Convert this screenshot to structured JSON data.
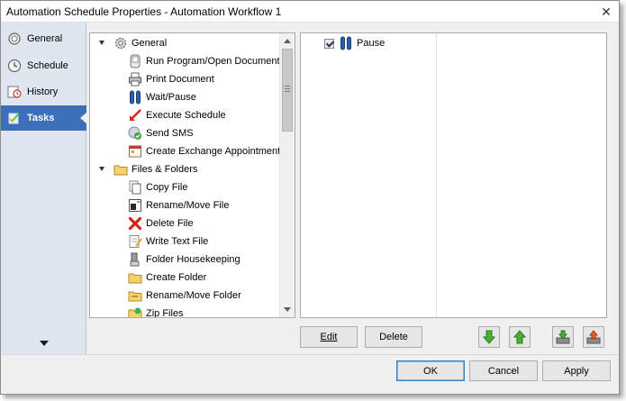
{
  "window": {
    "title": "Automation Schedule Properties - Automation Workflow 1",
    "close_glyph": "✕"
  },
  "sidebar": {
    "items": [
      {
        "label": "General",
        "icon": "general-icon",
        "active": false
      },
      {
        "label": "Schedule",
        "icon": "clock-icon",
        "active": false
      },
      {
        "label": "History",
        "icon": "history-icon",
        "active": false
      },
      {
        "label": "Tasks",
        "icon": "tasks-icon",
        "active": true
      }
    ],
    "accent": "#3d6fb8"
  },
  "task_tree": {
    "groups": [
      {
        "label": "General",
        "icon": "gear-icon",
        "items": [
          {
            "label": "Run Program/Open Document",
            "icon": "run-program-icon"
          },
          {
            "label": "Print Document",
            "icon": "printer-icon"
          },
          {
            "label": "Wait/Pause",
            "icon": "pause-icon"
          },
          {
            "label": "Execute Schedule",
            "icon": "execute-arrow-icon"
          },
          {
            "label": "Send SMS",
            "icon": "sms-icon"
          },
          {
            "label": "Create Exchange Appointment",
            "icon": "calendar-icon"
          }
        ]
      },
      {
        "label": "Files & Folders",
        "icon": "folder-icon",
        "items": [
          {
            "label": "Copy File",
            "icon": "copy-file-icon"
          },
          {
            "label": "Rename/Move File",
            "icon": "rename-file-icon"
          },
          {
            "label": "Delete File",
            "icon": "delete-x-icon"
          },
          {
            "label": "Write Text File",
            "icon": "write-text-icon"
          },
          {
            "label": "Folder Housekeeping",
            "icon": "housekeeping-icon"
          },
          {
            "label": "Create Folder",
            "icon": "create-folder-icon"
          },
          {
            "label": "Rename/Move Folder",
            "icon": "rename-folder-icon"
          },
          {
            "label": "Zip Files",
            "icon": "zip-icon"
          }
        ]
      }
    ]
  },
  "selected_tasks": [
    {
      "label": "Pause",
      "checked": true,
      "icon": "pause-icon"
    }
  ],
  "task_buttons": {
    "edit": "Edit",
    "delete": "Delete"
  },
  "footer": {
    "ok": "OK",
    "cancel": "Cancel",
    "apply": "Apply"
  }
}
